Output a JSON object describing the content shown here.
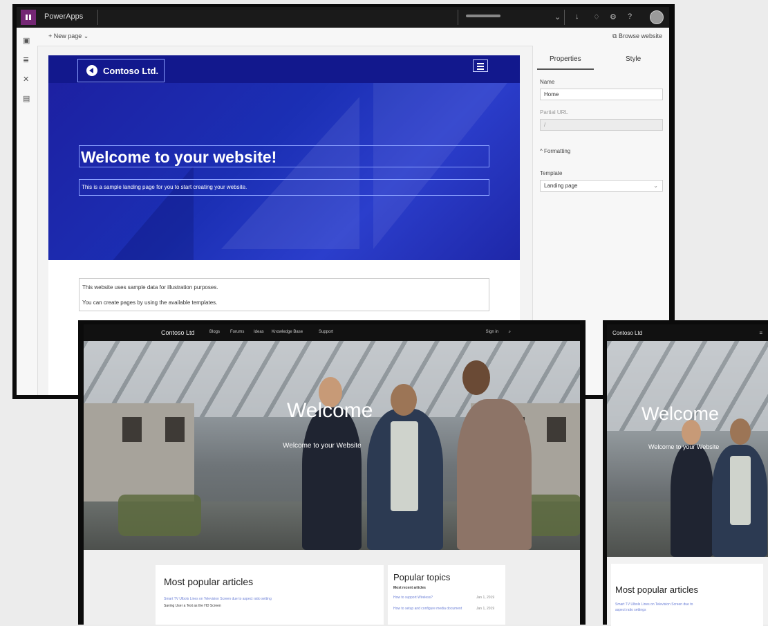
{
  "editor": {
    "app_name": "PowerApps",
    "new_page_label": "New page",
    "browse_website_label": "Browse website",
    "hero": {
      "logo_text": "Contoso Ltd.",
      "title": "Welcome to your website!",
      "subtitle": "This is a sample landing page for you to start creating your website."
    },
    "content_lines": [
      "This website uses sample data for illustration purposes.",
      "You can create pages by using the available templates."
    ],
    "properties": {
      "tabs": [
        "Properties",
        "Style"
      ],
      "name_label": "Name",
      "name_value": "Home",
      "partial_url_label": "Partial URL",
      "partial_url_value": "/",
      "formatting_label": "Formatting",
      "template_label": "Template",
      "template_value": "Landing page"
    },
    "icons": {
      "topbar": [
        "download-icon",
        "lightbulb-icon",
        "settings-icon",
        "help-icon",
        "avatar"
      ],
      "left_rail": [
        "page-icon",
        "layers-icon",
        "tools-icon",
        "theme-icon"
      ]
    }
  },
  "desktop_site": {
    "brand": "Contoso Ltd",
    "nav_links": [
      "Blogs",
      "Forums",
      "Ideas",
      "Knowledge Base",
      "Support"
    ],
    "signin": "Sign in",
    "hero_title": "Welcome",
    "hero_subtitle": "Welcome to your Website",
    "popular_articles": {
      "title": "Most popular articles",
      "line1": "Smart TV Ulbols Lines on Television Screen due to aspect ratio setting",
      "line2": "Saving User a Text as the HD Screen"
    },
    "popular_topics": {
      "title": "Popular topics",
      "subtitle": "Most recent articles",
      "items": [
        {
          "text": "How to support Wireless?",
          "date": "Jan 1, 2019"
        },
        {
          "text": "How to setup and configure media document",
          "date": "Jan 1, 2019"
        }
      ]
    }
  },
  "mobile_site": {
    "brand": "Contoso Ltd",
    "hero_title": "Welcome",
    "hero_subtitle": "Welcome to your Website",
    "articles_title": "Most popular articles",
    "article_line1": "Smart TV Ulbols Lines on Television Screen due to",
    "article_line2": "aspect ratio settings"
  },
  "colors": {
    "brand_purple": "#742774",
    "hero_blue": "#1b2fb4",
    "topbar": "#1a1a1a"
  }
}
